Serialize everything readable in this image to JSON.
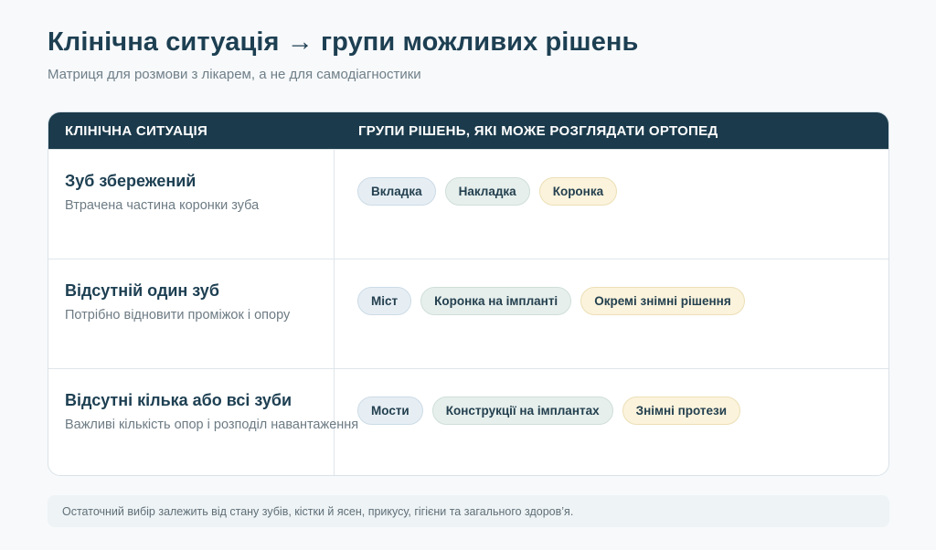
{
  "header": {
    "title": "Клінічна ситуація → групи можливих рішень",
    "subtitle": "Матриця для розмови з лікарем, а не для самодіагностики"
  },
  "table": {
    "columns": [
      "КЛІНІЧНА СИТУАЦІЯ",
      "ГРУПИ РІШЕНЬ, ЯКІ МОЖЕ РОЗГЛЯДАТИ ОРТОПЕД"
    ],
    "rows": [
      {
        "title": "Зуб збережений",
        "description": "Втрачена частина коронки зуба",
        "options": [
          {
            "label": "Вкладка",
            "tone": "blue"
          },
          {
            "label": "Накладка",
            "tone": "green"
          },
          {
            "label": "Коронка",
            "tone": "yellow"
          }
        ]
      },
      {
        "title": "Відсутній один зуб",
        "description": "Потрібно відновити проміжок і опору",
        "options": [
          {
            "label": "Міст",
            "tone": "blue"
          },
          {
            "label": "Коронка на імпланті",
            "tone": "green"
          },
          {
            "label": "Окремі знімні рішення",
            "tone": "yellow"
          }
        ]
      },
      {
        "title": "Відсутні кілька або всі зуби",
        "description": "Важливі кількість опор і розподіл навантаження",
        "options": [
          {
            "label": "Мости",
            "tone": "blue"
          },
          {
            "label": "Конструкції на імплантах",
            "tone": "green"
          },
          {
            "label": "Знімні протези",
            "tone": "yellow"
          }
        ]
      }
    ]
  },
  "footnote": "Остаточний вибір залежить від стану зубів, кістки й ясен, прикусу, гігієни та загального здоров’я.",
  "colors": {
    "header_bg": "#1b3b4c",
    "title": "#1d3f52",
    "chip_blue": "#e6eef4",
    "chip_green": "#e6efec",
    "chip_yellow": "#fbf3dc"
  }
}
